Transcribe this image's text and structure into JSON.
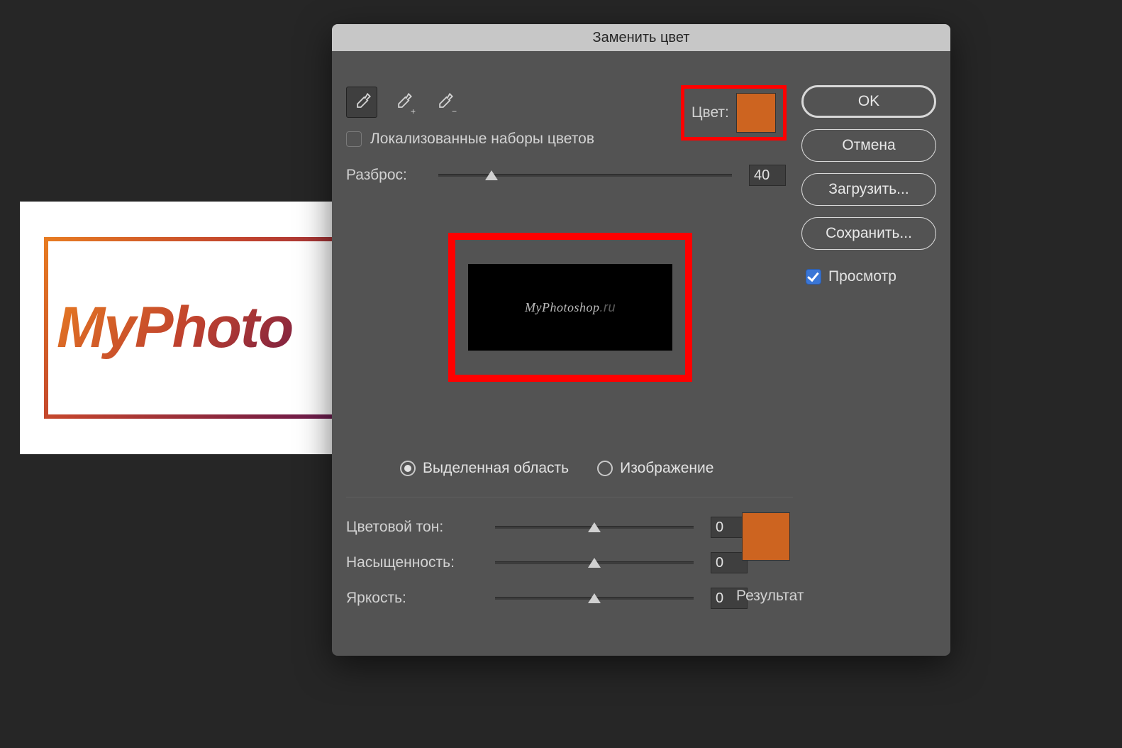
{
  "dialog": {
    "title": "Заменить цвет",
    "eyedroppers": [
      {
        "name": "eyedropper",
        "active": true,
        "pm": ""
      },
      {
        "name": "eyedropper-add",
        "active": false,
        "pm": "+"
      },
      {
        "name": "eyedropper-subtract",
        "active": false,
        "pm": "−"
      }
    ],
    "localize_label": "Локализованные наборы цветов",
    "localize_checked": false,
    "color_label": "Цвет:",
    "color_swatch": "#cd6420",
    "fuzziness": {
      "label": "Разброс:",
      "value": "40",
      "pct": 18
    },
    "preview_text_hint": "MyPhotoshop...",
    "view_mode": {
      "selection_label": "Выделенная область",
      "image_label": "Изображение",
      "selected": "selection"
    },
    "adjust": {
      "hue": {
        "label": "Цветовой тон:",
        "value": "0"
      },
      "saturation": {
        "label": "Насыщенность:",
        "value": "0"
      },
      "lightness": {
        "label": "Яркость:",
        "value": "0"
      },
      "result_label": "Результат",
      "result_swatch": "#cd6420"
    },
    "buttons": {
      "ok": "OK",
      "cancel": "Отмена",
      "load": "Загрузить...",
      "save": "Сохранить..."
    },
    "preview_checkbox": {
      "label": "Просмотр",
      "checked": true
    }
  },
  "canvas": {
    "text": "MyPhoto"
  }
}
